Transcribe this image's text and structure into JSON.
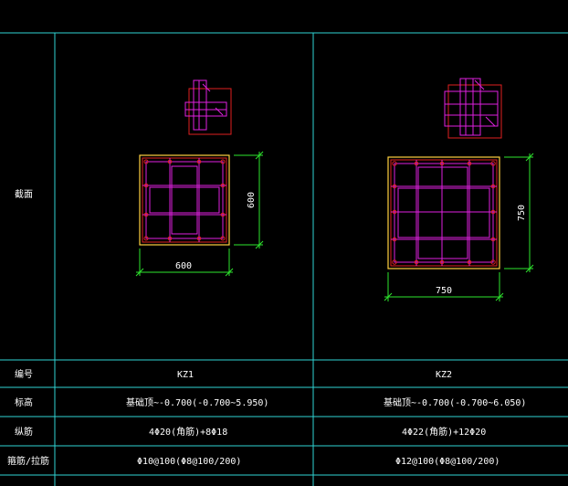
{
  "table": {
    "row_labels": {
      "section": "截面",
      "number": "编号",
      "elevation": "标高",
      "longitudinal": "纵筋",
      "stirrup": "箍筋/拉筋"
    },
    "columns": [
      {
        "id": "KZ1",
        "width_dim": "600",
        "height_dim": "600",
        "elevation": "基础顶~-0.700(-0.700~5.950)",
        "longitudinal": "4Φ20(角筋)+8Φ18",
        "stirrup": "Φ10@100(Φ8@100/200)"
      },
      {
        "id": "KZ2",
        "width_dim": "750",
        "height_dim": "750",
        "elevation": "基础顶~-0.700(-0.700~6.050)",
        "longitudinal": "4Φ22(角筋)+12Φ20",
        "stirrup": "Φ12@100(Φ8@100/200)"
      }
    ]
  },
  "colors": {
    "grid": "#2fd3d3",
    "dimension": "#2ee62e",
    "stirrup": "#e020e0",
    "bar": "#e02020",
    "outline": "#ffd040"
  }
}
